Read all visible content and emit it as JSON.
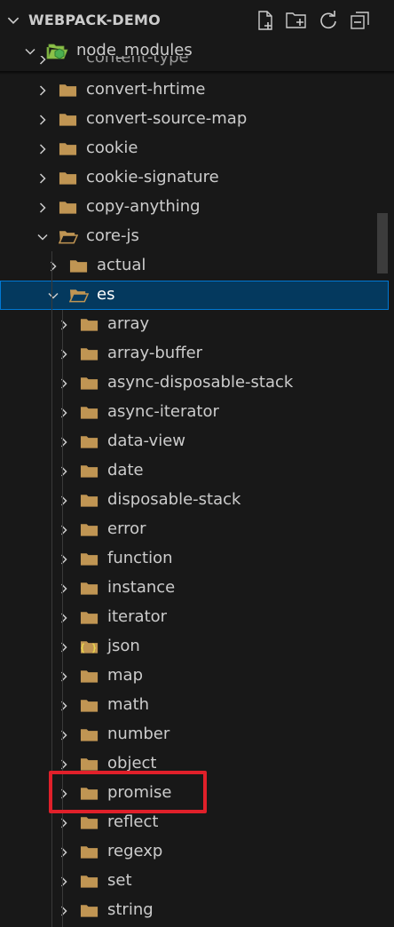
{
  "explorer": {
    "title": "WEBPACK-DEMO",
    "actions": [
      {
        "name": "new-file-icon"
      },
      {
        "name": "new-folder-icon"
      },
      {
        "name": "refresh-icon"
      },
      {
        "name": "collapse-all-icon"
      }
    ]
  },
  "tree": {
    "root": {
      "label": "node_modules",
      "icon": "node-folder-icon"
    },
    "partial_top": "content-type",
    "level1": [
      {
        "label": "convert-hrtime",
        "expanded": false
      },
      {
        "label": "convert-source-map",
        "expanded": false
      },
      {
        "label": "cookie",
        "expanded": false
      },
      {
        "label": "cookie-signature",
        "expanded": false
      },
      {
        "label": "copy-anything",
        "expanded": false
      },
      {
        "label": "core-js",
        "expanded": true
      }
    ],
    "level2": [
      {
        "label": "actual",
        "expanded": false
      },
      {
        "label": "es",
        "expanded": true,
        "selected": true
      }
    ],
    "level3": [
      {
        "label": "array"
      },
      {
        "label": "array-buffer"
      },
      {
        "label": "async-disposable-stack"
      },
      {
        "label": "async-iterator"
      },
      {
        "label": "data-view"
      },
      {
        "label": "date"
      },
      {
        "label": "disposable-stack"
      },
      {
        "label": "error"
      },
      {
        "label": "function"
      },
      {
        "label": "instance"
      },
      {
        "label": "iterator"
      },
      {
        "label": "json",
        "icon": "json-folder-icon"
      },
      {
        "label": "map"
      },
      {
        "label": "math"
      },
      {
        "label": "number"
      },
      {
        "label": "object"
      },
      {
        "label": "promise",
        "highlighted": true
      },
      {
        "label": "reflect"
      },
      {
        "label": "regexp"
      },
      {
        "label": "set"
      },
      {
        "label": "string"
      }
    ]
  },
  "colors": {
    "background": "#181818",
    "selection": "#04395e",
    "selection_border": "#0078d4",
    "folder": "#c09553",
    "highlight": "#e0202a"
  }
}
